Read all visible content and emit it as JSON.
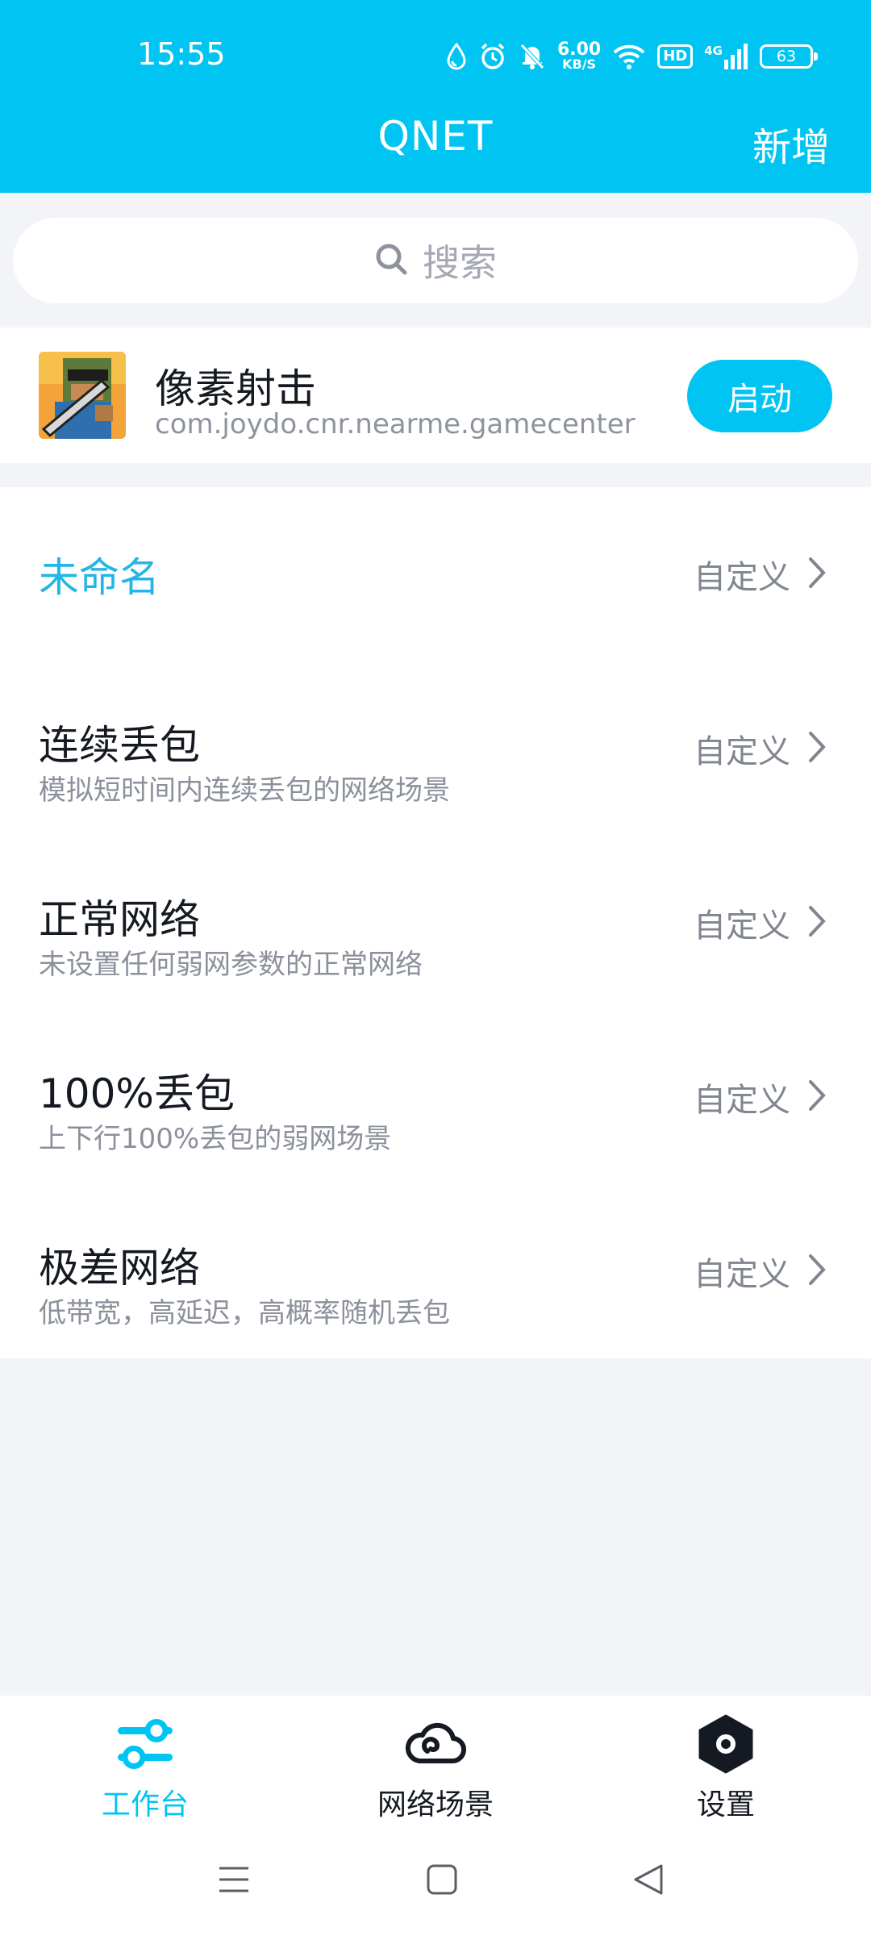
{
  "status_bar": {
    "time": "15:55",
    "net_speed_value": "6.00",
    "net_speed_unit": "KB/S",
    "hd_label": "HD",
    "signal_label": "4G",
    "battery_level": "63"
  },
  "header": {
    "title": "QNET",
    "add_label": "新增"
  },
  "search": {
    "placeholder": "搜索"
  },
  "app_card": {
    "name": "像素射击",
    "package": "com.joydo.cnr.nearme.gamecenter",
    "launch_label": "启动"
  },
  "scenes": [
    {
      "title": "未命名",
      "description": "",
      "action": "自定义"
    },
    {
      "title": "连续丢包",
      "description": "模拟短时间内连续丢包的网络场景",
      "action": "自定义"
    },
    {
      "title": "正常网络",
      "description": "未设置任何弱网参数的正常网络",
      "action": "自定义"
    },
    {
      "title": "100%丢包",
      "description": "上下行100%丢包的弱网场景",
      "action": "自定义"
    },
    {
      "title": "极差网络",
      "description": "低带宽，高延迟，高概率随机丢包",
      "action": "自定义"
    }
  ],
  "bottom_nav": {
    "items": [
      {
        "label": "工作台",
        "icon": "sliders-icon",
        "active": true
      },
      {
        "label": "网络场景",
        "icon": "cloud-icon",
        "active": false
      },
      {
        "label": "设置",
        "icon": "hexagon-settings-icon",
        "active": false
      }
    ]
  },
  "colors": {
    "accent": "#00c5f2",
    "background": "#f3f4f8",
    "text_primary": "#151a22",
    "text_secondary": "#8b909b"
  }
}
